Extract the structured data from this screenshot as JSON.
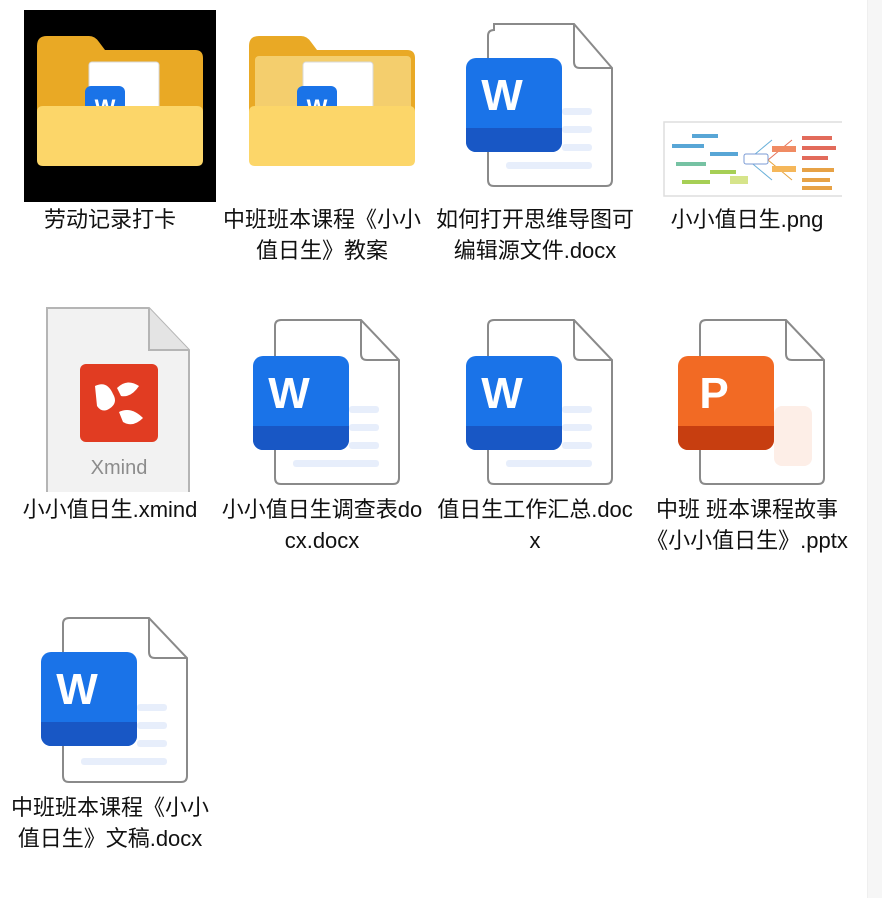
{
  "files": [
    {
      "name": "劳动记录打卡",
      "type": "folder",
      "icon": "folder-icon",
      "selected": true
    },
    {
      "name": "中班班本课程《小小值日生》教案",
      "type": "folder",
      "icon": "folder-icon",
      "selected": false
    },
    {
      "name": "如何打开思维导图可编辑源文件.docx",
      "type": "docx",
      "icon": "word-document-icon"
    },
    {
      "name": "小小值日生.png",
      "type": "png",
      "icon": "image-thumbnail-icon"
    },
    {
      "name": "小小值日生.xmind",
      "type": "xmind",
      "icon": "xmind-file-icon",
      "badge": "Xmind"
    },
    {
      "name": "小小值日生调查表docx.docx",
      "type": "docx",
      "icon": "word-document-icon"
    },
    {
      "name": "值日生工作汇总.docx",
      "type": "docx",
      "icon": "word-document-icon"
    },
    {
      "name": "中班 班本课程故事《小小值日生》.pptx",
      "type": "pptx",
      "icon": "powerpoint-document-icon"
    },
    {
      "name": "中班班本课程《小小值日生》文稿.docx",
      "type": "docx",
      "icon": "word-document-icon"
    }
  ],
  "colors": {
    "word_blue": "#1a73e8",
    "word_blue_dark": "#1857c5",
    "ppt_orange": "#e7521e",
    "ppt_orange_dark": "#c73e10",
    "xmind_red": "#e13c22",
    "folder_yellow": "#f8c94a",
    "folder_front": "#fcd669",
    "selection": "#000000"
  },
  "icon_letters": {
    "word": "W",
    "powerpoint": "P"
  }
}
